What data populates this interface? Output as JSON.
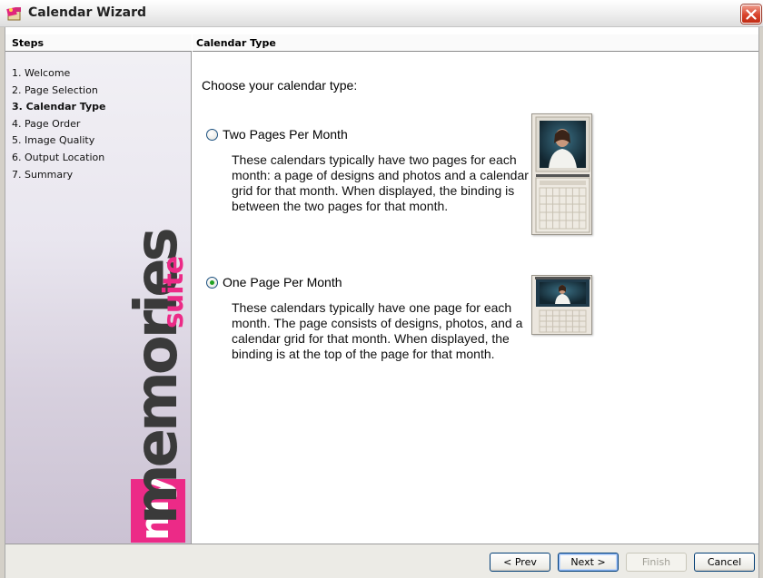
{
  "window": {
    "title": "Calendar Wizard",
    "icon": "calendar-app-icon",
    "close_icon": "close-icon"
  },
  "steps": {
    "header": "Steps",
    "items": [
      {
        "label": "1. Welcome",
        "current": false
      },
      {
        "label": "2. Page Selection",
        "current": false
      },
      {
        "label": "3. Calendar Type",
        "current": true
      },
      {
        "label": "4. Page Order",
        "current": false
      },
      {
        "label": "5. Image Quality",
        "current": false
      },
      {
        "label": "6. Output Location",
        "current": false
      },
      {
        "label": "7. Summary",
        "current": false
      }
    ]
  },
  "logo": {
    "my": "my",
    "memories": "memories",
    "suite": "suite",
    "colors": {
      "pink": "#ec2a87",
      "dark": "#3a3a3a"
    }
  },
  "content": {
    "header": "Calendar Type",
    "prompt": "Choose your calendar type:",
    "options": [
      {
        "label": "Two Pages Per Month",
        "selected": false,
        "description": "These calendars typically have two pages for each month: a page of designs and photos and a calendar grid for that month. When displayed, the binding is between the two pages for that month.",
        "preview": "two-page-calendar-preview"
      },
      {
        "label": "One Page Per Month",
        "selected": true,
        "description": "These calendars typically have one page for each month. The page consists of designs, photos, and a calendar grid for that month. When displayed, the binding is at the top of the page for that month.",
        "preview": "one-page-calendar-preview"
      }
    ]
  },
  "buttons": {
    "prev": "< Prev",
    "next": "Next >",
    "finish": "Finish",
    "cancel": "Cancel"
  }
}
